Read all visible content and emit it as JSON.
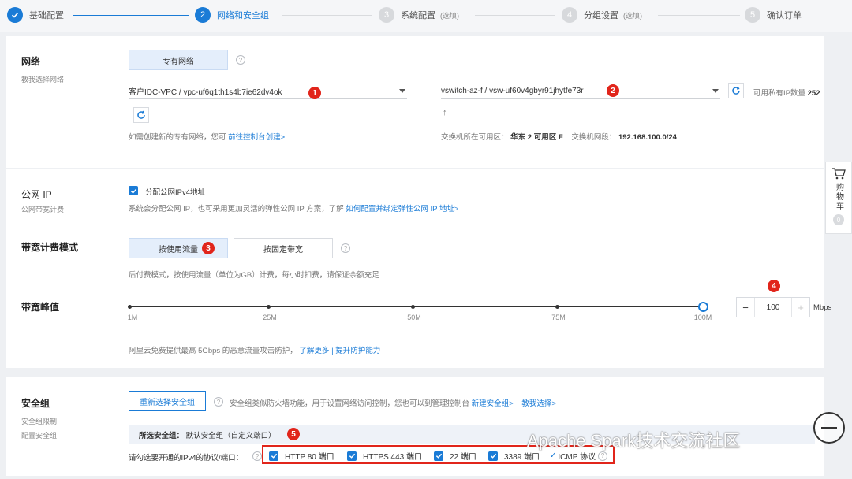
{
  "steps": [
    {
      "num": "✓",
      "label": "基础配置",
      "optional": ""
    },
    {
      "num": "2",
      "label": "网络和安全组",
      "optional": ""
    },
    {
      "num": "3",
      "label": "系统配置",
      "optional": "(选填)"
    },
    {
      "num": "4",
      "label": "分组设置",
      "optional": "(选填)"
    },
    {
      "num": "5",
      "label": "确认订单",
      "optional": ""
    }
  ],
  "network": {
    "title": "网络",
    "subtitle": "教我选择网络",
    "type_button": "专有网络",
    "help": "?",
    "vpc_value": "客户IDC-VPC / vpc-uf6q1th1s4b7ie62dv4ok",
    "vswitch_value": "vswitch-az-f / vsw-uf60v4gbyr91jhytfe73r",
    "available_ip_label": "可用私有IP数量",
    "available_ip_count": "252",
    "create_hint_prefix": "如需创建新的专有网络，您可",
    "create_hint_link": "前往控制台创建>",
    "up_arrow": "↑",
    "zone_label": "交换机所在可用区：",
    "zone_value": "华东 2 可用区 F",
    "cidr_label": "交换机网段：",
    "cidr_value": "192.168.100.0/24"
  },
  "badges": [
    "1",
    "2",
    "3",
    "4",
    "5"
  ],
  "public_ip": {
    "title": "公网 IP",
    "subtitle": "公网带宽计费",
    "checkbox_label": "分配公网IPv4地址",
    "desc_prefix": "系统会分配公网 IP，也可采用更加灵活的弹性公网 IP 方案，了解",
    "desc_link": "如何配置并绑定弹性公网 IP 地址>"
  },
  "billing": {
    "title": "带宽计费模式",
    "by_traffic": "按使用流量",
    "by_fixed": "按固定带宽",
    "help": "?",
    "desc": "后付费模式，按使用流量（单位为GB）计费，每小时扣费，请保证余额充足"
  },
  "bandwidth": {
    "title": "带宽峰值",
    "ticks": [
      "1M",
      "25M",
      "50M",
      "75M",
      "100M"
    ],
    "value": "100",
    "unit": "Mbps",
    "minus": "−",
    "plus": "+",
    "protect_prefix": "阿里云免费提供最高 5Gbps 的恶意流量攻击防护，",
    "protect_link1": "了解更多",
    "protect_sep": " | ",
    "protect_link2": "提升防护能力"
  },
  "security": {
    "title": "安全组",
    "subtitle1": "安全组限制",
    "subtitle2": "配置安全组",
    "reselect_button": "重新选择安全组",
    "help": "?",
    "desc_prefix": "安全组类似防火墙功能，用于设置网络访问控制，您也可以到管理控制台",
    "desc_link1": "新建安全组>",
    "desc_link2": "教我选择>",
    "selected_label": "所选安全组：",
    "selected_value": "默认安全组（自定义端口）",
    "ports_label": "请勾选要开通的IPv4的协议/端口：",
    "ports": [
      "HTTP 80 端口",
      "HTTPS 443 端口",
      "22 端口",
      "3389 端口"
    ],
    "icmp_label": "ICMP 协议",
    "icmp_check": "✓"
  },
  "cart": {
    "label": "购物车",
    "count": "0"
  },
  "watermark": "Apache Spark技术交流社区"
}
